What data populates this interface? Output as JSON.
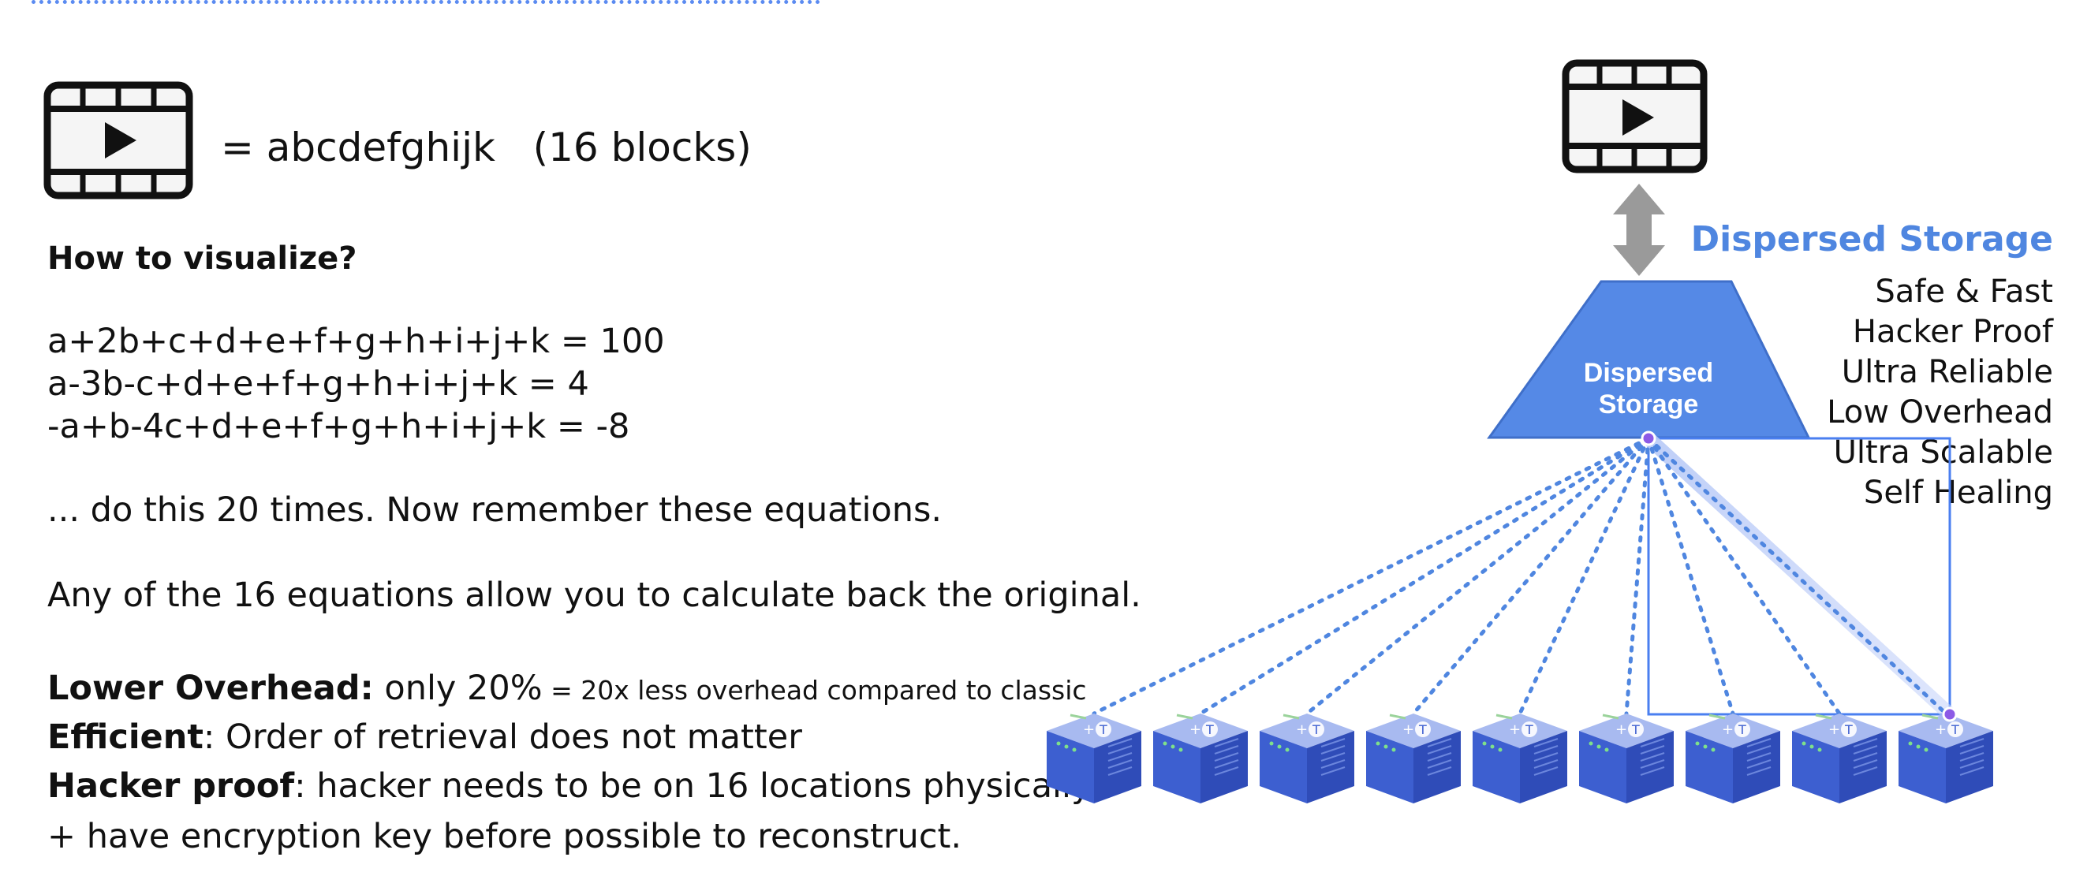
{
  "header": {
    "formula": "= abcdefghijk   (16 blocks)"
  },
  "left": {
    "heading": "How to visualize?",
    "equations": [
      "a+2b+c+d+e+f+g+h+i+j+k = 100",
      "a-3b-c+d+e+f+g+h+i+j+k = 4",
      "-a+b-4c+d+e+f+g+h+i+j+k = -8"
    ],
    "repeat_note": "... do this 20 times. Now remember these equations.",
    "any_note": "Any of the 16 equations allow you to calculate back the original.",
    "points": {
      "overhead_label": "Lower Overhead:",
      "overhead_text": " only 20%",
      "overhead_small": " = 20x less overhead compared to classic",
      "efficient_label": "Efficient",
      "efficient_text": ": Order of retrieval does not matter",
      "hacker_label": "Hacker proof",
      "hacker_text": ": hacker needs to be on 16 locations physically",
      "encryption_text": "+ have encryption key before possible to reconstruct."
    }
  },
  "diagram": {
    "storage_label_line1": "Dispersed",
    "storage_label_line2": "Storage",
    "panel_title": "Dispersed Storage",
    "features": [
      "Safe & Fast",
      "Hacker Proof",
      "Ultra Reliable",
      "Low Overhead",
      "Ultra Scalable",
      "Self Healing"
    ],
    "node_count": 9,
    "colors": {
      "accent": "#4f86e0",
      "trapezoid": "#5589e6",
      "arrow": "#9a9a9a",
      "node_top": "#a8baf0",
      "node_front": "#3d5fd0",
      "node_side": "#2f4cb8"
    },
    "icons": [
      "video-file-icon",
      "double-arrow-icon",
      "storage-node-icon"
    ]
  }
}
